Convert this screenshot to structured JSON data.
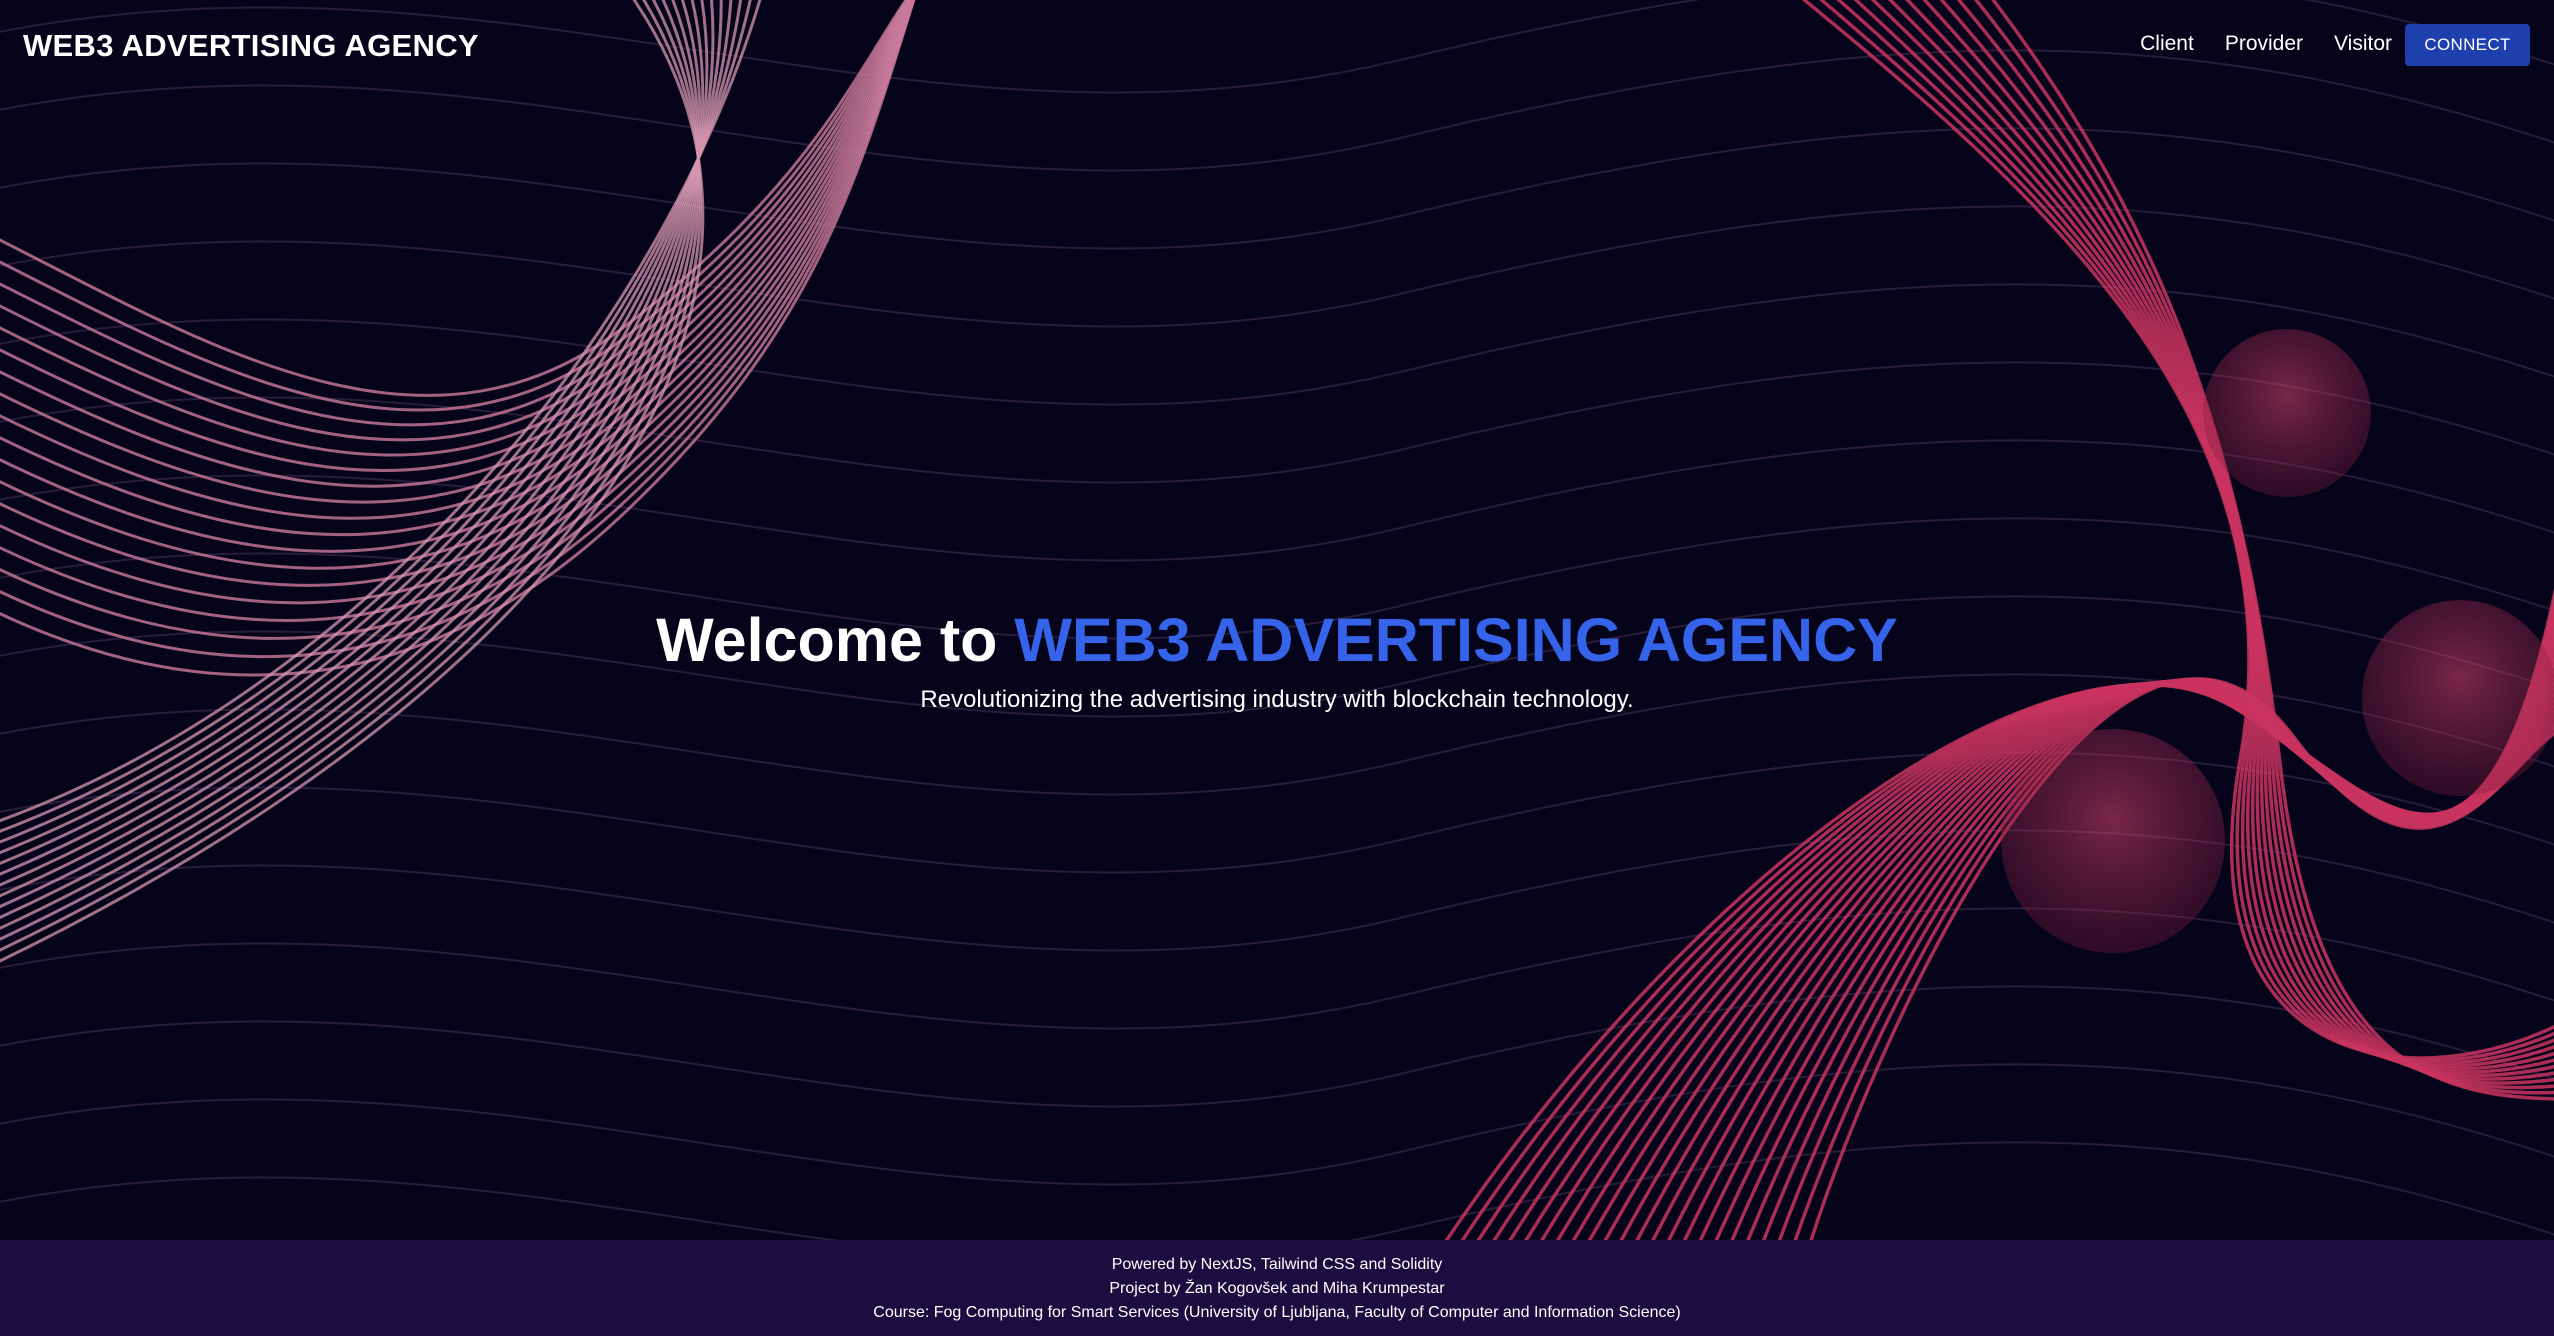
{
  "header": {
    "brand": "WEB3 ADVERTISING AGENCY",
    "nav": [
      {
        "label": "Client"
      },
      {
        "label": "Provider"
      },
      {
        "label": "Visitor"
      }
    ],
    "connect_label": "CONNECT"
  },
  "hero": {
    "title_prefix": "Welcome to",
    "title_accent": "WEB3 ADVERTISING AGENCY",
    "subtitle": "Revolutionizing the advertising industry with blockchain technology."
  },
  "footer": {
    "lines": [
      "Powered by NextJS, Tailwind CSS and Solidity",
      "Project by Žan Kogovšek and Miha Krumpestar",
      "Course: Fog Computing for Smart Services (University of Ljubljana, Faculty of Computer and Information Science)"
    ]
  },
  "colors": {
    "background": "#05041a",
    "accent": "#3563e9",
    "button": "#1e40af",
    "footer": "#1a0d3f",
    "wave_left": "#c97a9a",
    "wave_right": "#c9345f"
  }
}
